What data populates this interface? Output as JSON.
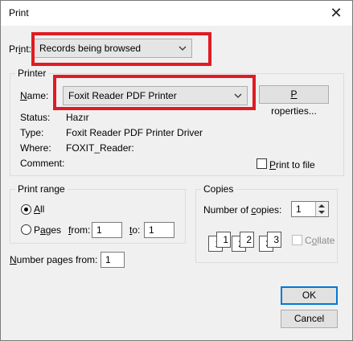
{
  "window": {
    "title": "Print",
    "close_icon": "close-icon"
  },
  "print": {
    "label_prefix": "Pr",
    "label_access": "i",
    "label_suffix": "nt:",
    "value": "Records being browsed"
  },
  "printer": {
    "group_label": "Printer",
    "name_label_access": "N",
    "name_label_rest": "ame:",
    "name_value": "Foxit Reader PDF Printer",
    "properties_access": "P",
    "properties_rest": "roperties...",
    "status_label": "Status:",
    "status_value": "Hazır",
    "type_label": "Type:",
    "type_value": "Foxit Reader PDF Printer Driver",
    "where_label": "Where:",
    "where_value": "FOXIT_Reader:",
    "comment_label": "Comment:",
    "print_to_file_access": "P",
    "print_to_file_rest": "rint to file"
  },
  "print_range": {
    "group_label": "Print range",
    "all_access": "A",
    "all_rest": "ll",
    "pages_prefix": "P",
    "pages_access": "a",
    "pages_rest": "ges",
    "from_access": "f",
    "from_rest": "rom:",
    "from_value": "1",
    "to_access": "t",
    "to_rest": "o:",
    "to_value": "1"
  },
  "copies": {
    "group_label": "Copies",
    "number_prefix": "Number of ",
    "number_access": "c",
    "number_rest": "opies:",
    "number_value": "1",
    "collate_prefix": "C",
    "collate_access": "o",
    "collate_rest": "llate",
    "collate_pages": [
      "1",
      "1",
      "2",
      "2",
      "3",
      "3"
    ]
  },
  "number_pages": {
    "label_access": "N",
    "label_rest": "umber pages from:",
    "value": "1"
  },
  "buttons": {
    "ok": "OK",
    "cancel": "Cancel"
  },
  "colors": {
    "highlight": "#e01b24",
    "dialog_bg": "#f0f0f0",
    "default_border": "#0078d7"
  }
}
